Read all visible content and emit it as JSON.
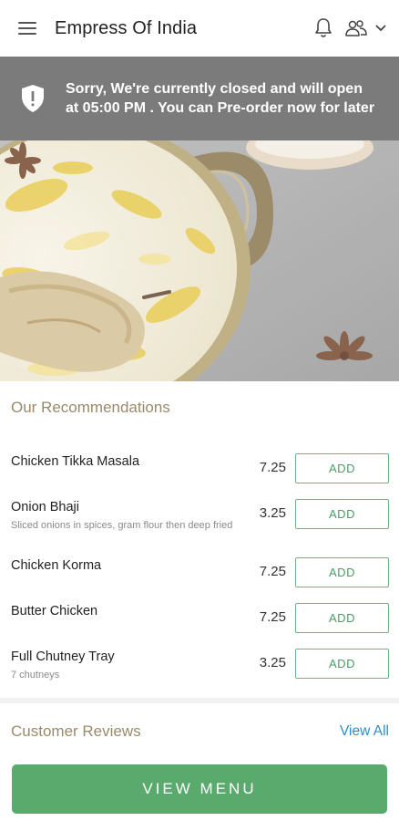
{
  "header": {
    "title": "Empress Of India",
    "menu_icon": "hamburger-icon",
    "bell_icon": "bell-icon",
    "user_icon": "users-icon",
    "dropdown_icon": "chevron-down-icon"
  },
  "banner": {
    "icon": "shield-icon",
    "message": "Sorry, We're currently closed and will open at 05:00 PM . You can Pre-order now for later"
  },
  "recommendations": {
    "title": "Our Recommendations",
    "add_label": "ADD",
    "items": [
      {
        "name": "Chicken Tikka Masala",
        "description": "",
        "price": "7.25"
      },
      {
        "name": "Onion Bhaji",
        "description": "Sliced onions in spices, gram flour then deep fried",
        "price": "3.25"
      },
      {
        "name": "Chicken Korma",
        "description": "",
        "price": "7.25"
      },
      {
        "name": "Butter Chicken",
        "description": "",
        "price": "7.25"
      },
      {
        "name": "Full Chutney Tray",
        "description": "7 chutneys",
        "price": "3.25"
      }
    ]
  },
  "reviews": {
    "title": "Customer Reviews",
    "view_all": "View All"
  },
  "footer": {
    "view_menu": "VIEW MENU"
  },
  "colors": {
    "banner_bg": "#7b7b7b",
    "accent_green": "#5aaa6e",
    "section_title": "#9a8a6a",
    "link_blue": "#2f8cc9"
  }
}
